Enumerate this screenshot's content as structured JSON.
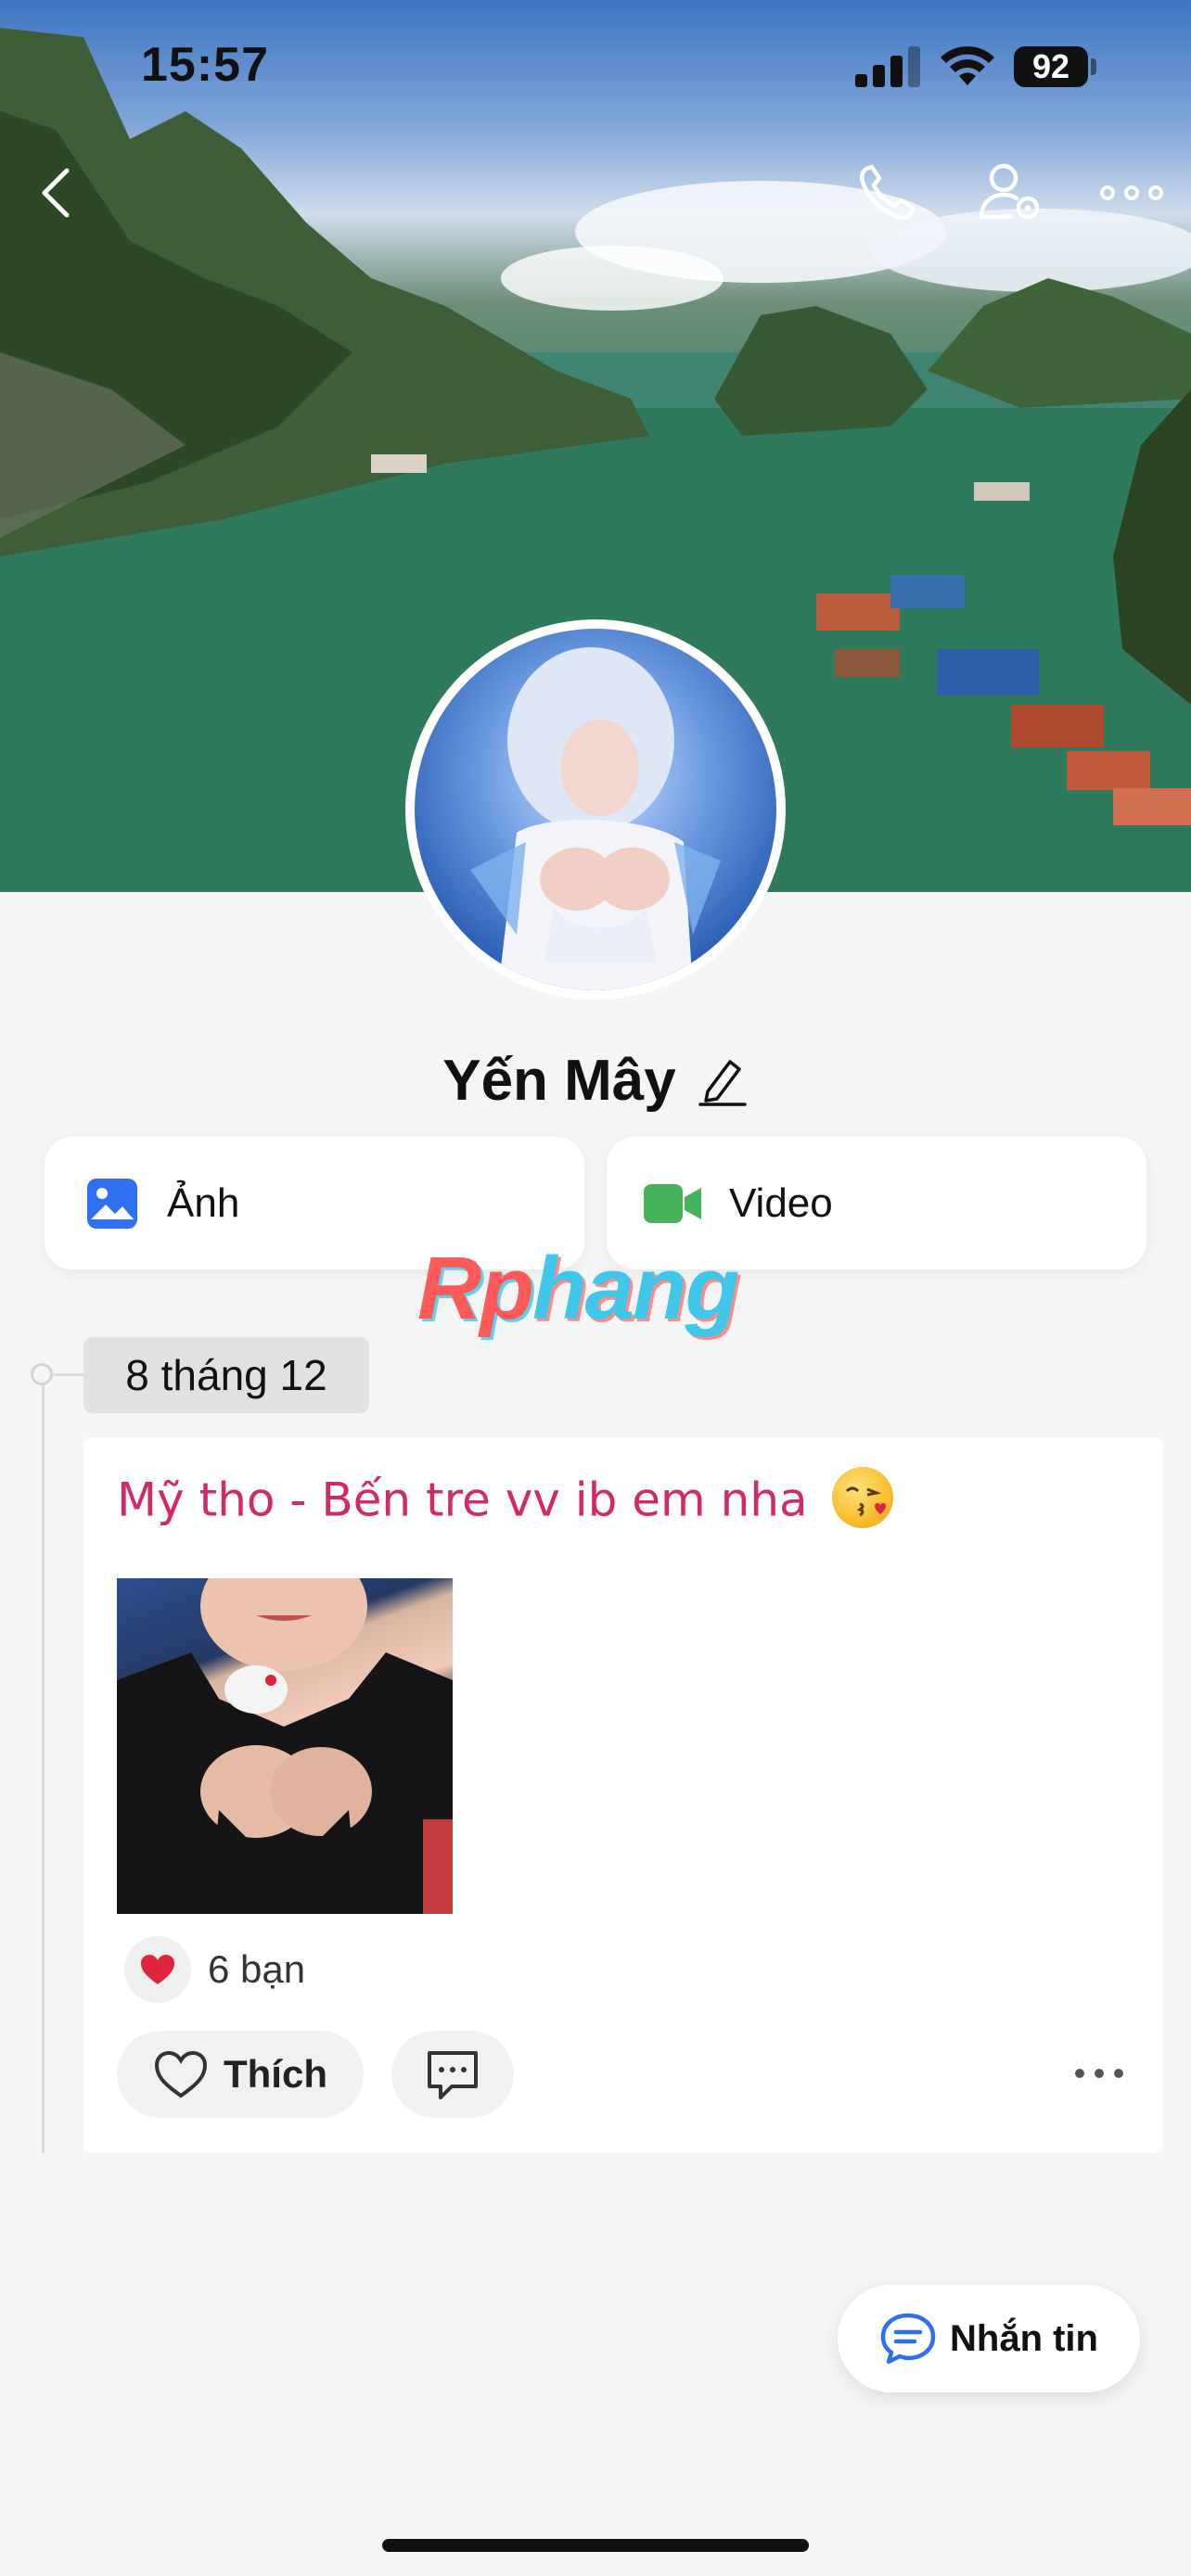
{
  "status_bar": {
    "time": "15:57",
    "battery": "92",
    "signal_bars_active": 3,
    "signal_bars_total": 4
  },
  "header": {
    "icons": [
      "back-icon",
      "phone-icon",
      "user-settings-icon",
      "more-icon"
    ]
  },
  "profile": {
    "name": "Yến Mây",
    "edit_icon": "pencil-icon"
  },
  "media_buttons": {
    "photo_label": "Ảnh",
    "video_label": "Video",
    "photo_color": "#2f6ff0",
    "video_color": "#46b35a"
  },
  "watermark": {
    "part_a": "Rp",
    "part_b": "hang"
  },
  "timeline": {
    "date": "8 tháng 12"
  },
  "post": {
    "text": "Mỹ tho - Bến tre vv ib em nha",
    "reaction_count": "6 bạn",
    "like_label": "Thích",
    "text_color": "#d12a6a"
  },
  "fab": {
    "label": "Nhắn tin"
  },
  "colors": {
    "accent": "#2f6ff0",
    "background": "#f4f5f5",
    "heart": "#e0263c"
  }
}
